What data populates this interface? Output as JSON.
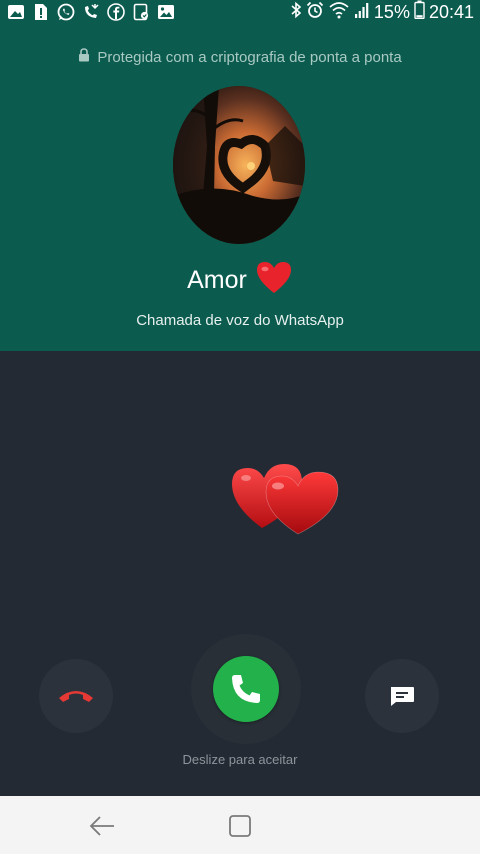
{
  "status_bar": {
    "battery": "15%",
    "time": "20:41",
    "left_icons": [
      "image-icon",
      "sim-alert-icon",
      "whatsapp-icon",
      "missed-call-icon",
      "facebook-icon",
      "contact-card-icon",
      "gallery-icon"
    ],
    "right_icons": [
      "bluetooth-icon",
      "alarm-icon",
      "wifi-icon",
      "signal-icon",
      "battery-icon"
    ]
  },
  "header": {
    "encryption_text": "Protegida com a criptografia de ponta a ponta",
    "caller_name": "Amor",
    "call_type": "Chamada de voz do WhatsApp"
  },
  "actions": {
    "slide_hint": "Deslize para aceitar"
  },
  "colors": {
    "header_bg": "#0b5b4e",
    "body_bg": "#232a33",
    "accept": "#22b14a",
    "decline_icon": "#e53935"
  }
}
